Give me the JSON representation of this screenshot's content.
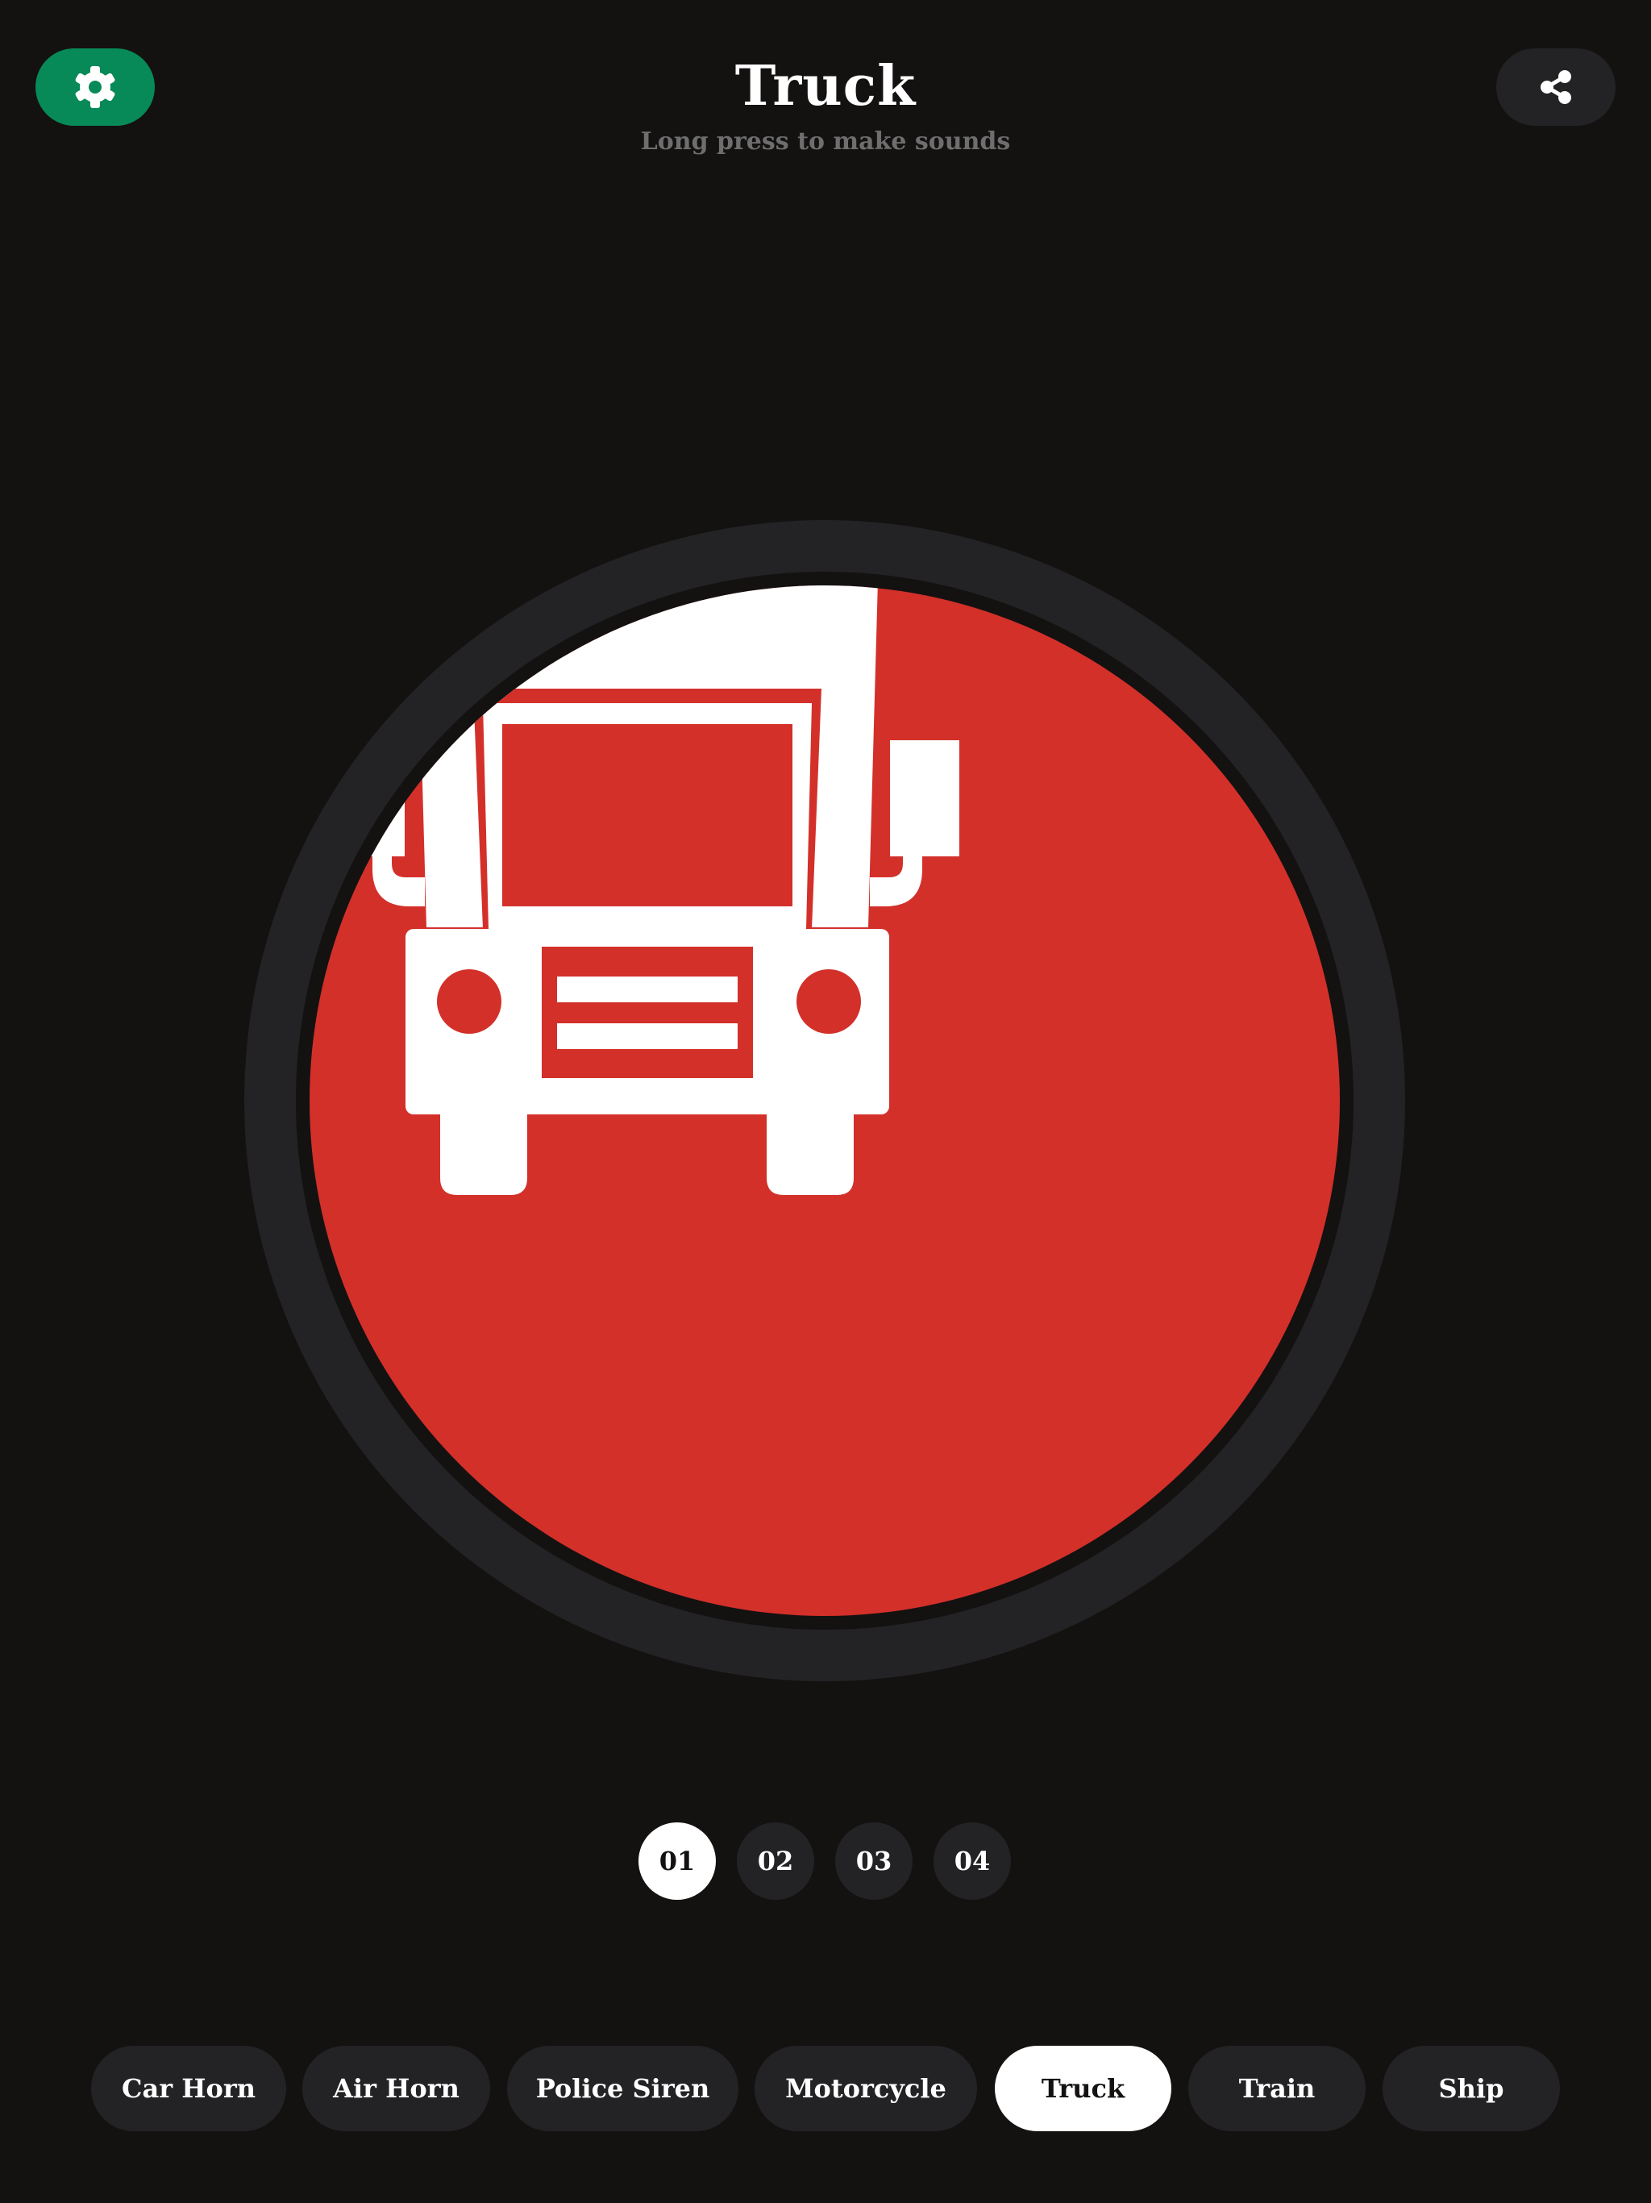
{
  "header": {
    "title": "Truck",
    "subtitle": "Long press to make sounds",
    "settings_icon": "gear-icon",
    "share_icon": "share-icon"
  },
  "main": {
    "button_icon": "truck-icon",
    "button_color": "#d3302a",
    "ring_color": "#232325"
  },
  "variants": {
    "items": [
      "01",
      "02",
      "03",
      "04"
    ],
    "selected": "01"
  },
  "categories": {
    "items": [
      "Car Horn",
      "Air Horn",
      "Police Siren",
      "Motorcycle",
      "Truck",
      "Train",
      "Ship"
    ],
    "selected": "Truck"
  },
  "colors": {
    "background": "#141111",
    "settings_accent": "#078a58",
    "chip_bg": "#232325",
    "active_bg": "#ffffff"
  }
}
